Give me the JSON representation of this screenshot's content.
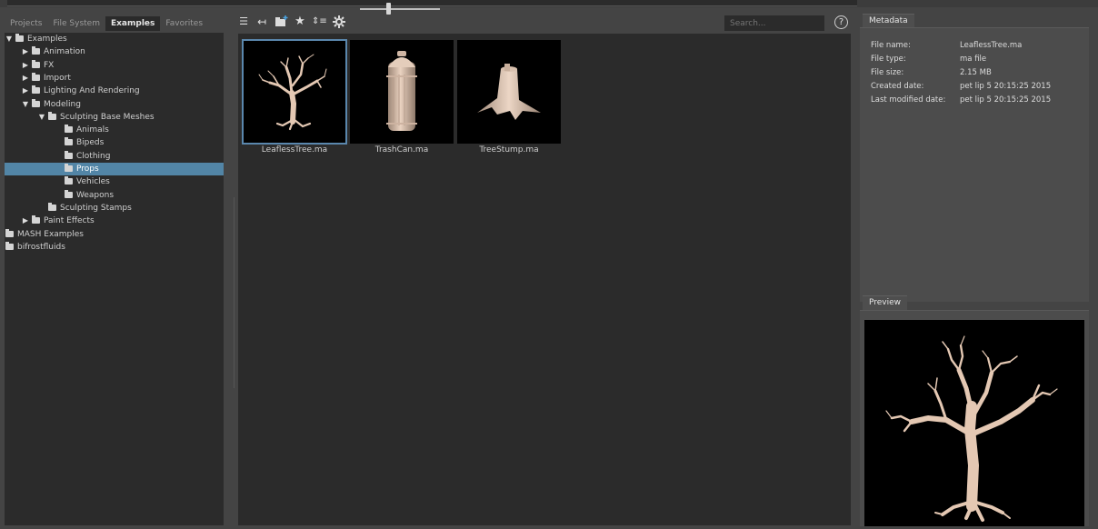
{
  "tabs": [
    "Projects",
    "File System",
    "Examples",
    "Favorites"
  ],
  "active_tab": "Examples",
  "tree": [
    {
      "label": "Examples",
      "depth": 0,
      "arrow": "down"
    },
    {
      "label": "Animation",
      "depth": 1,
      "arrow": "right"
    },
    {
      "label": "FX",
      "depth": 1,
      "arrow": "right"
    },
    {
      "label": "Import",
      "depth": 1,
      "arrow": "right"
    },
    {
      "label": "Lighting And Rendering",
      "depth": 1,
      "arrow": "right"
    },
    {
      "label": "Modeling",
      "depth": 1,
      "arrow": "down"
    },
    {
      "label": "Sculpting Base Meshes",
      "depth": 2,
      "arrow": "down"
    },
    {
      "label": "Animals",
      "depth": 3,
      "arrow": ""
    },
    {
      "label": "Bipeds",
      "depth": 3,
      "arrow": ""
    },
    {
      "label": "Clothing",
      "depth": 3,
      "arrow": ""
    },
    {
      "label": "Props",
      "depth": 3,
      "arrow": "",
      "selected": true
    },
    {
      "label": "Vehicles",
      "depth": 3,
      "arrow": ""
    },
    {
      "label": "Weapons",
      "depth": 3,
      "arrow": ""
    },
    {
      "label": "Sculpting Stamps",
      "depth": 2,
      "arrow": ""
    },
    {
      "label": "Paint Effects",
      "depth": 1,
      "arrow": "right"
    },
    {
      "label": "MASH Examples",
      "depth": 0,
      "arrow": ""
    },
    {
      "label": "bifrostfluids",
      "depth": 0,
      "arrow": ""
    }
  ],
  "toolbar": {
    "icons": [
      "list-view-icon",
      "back-icon",
      "new-folder-icon",
      "favorite-star-icon",
      "sort-icon",
      "settings-gear-icon"
    ],
    "thumbnail_size": 0.35,
    "search_placeholder": "Search...",
    "help_label": "?"
  },
  "files": [
    {
      "name": "LeaflessTree.ma",
      "selected": true
    },
    {
      "name": "TrashCan.ma",
      "selected": false
    },
    {
      "name": "TreeStump.ma",
      "selected": false
    }
  ],
  "metadata": {
    "title": "Metadata",
    "rows": [
      {
        "label": "File name:",
        "value": "LeaflessTree.ma"
      },
      {
        "label": "File type:",
        "value": "ma file"
      },
      {
        "label": "File size:",
        "value": "2.15 MB"
      },
      {
        "label": "Created date:",
        "value": "pet lip 5 20:15:25 2015"
      },
      {
        "label": "Last modified date:",
        "value": "pet lip 5 20:15:25 2015"
      }
    ]
  },
  "preview": {
    "title": "Preview"
  },
  "colors": {
    "selection": "#5285a6",
    "model": "#e4c8b3",
    "panel_dark": "#2b2b2b",
    "panel": "#444444"
  }
}
